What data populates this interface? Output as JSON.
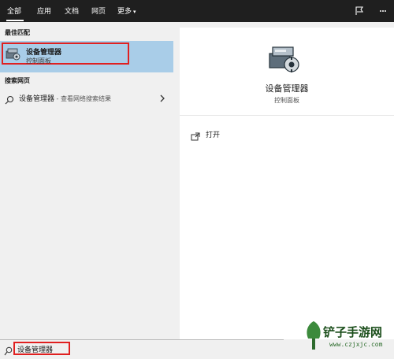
{
  "tabs": {
    "all": "全部",
    "apps": "应用",
    "docs": "文档",
    "web": "网页",
    "more": "更多",
    "more_caret": "▾",
    "feedback_icon": "feedback-icon",
    "options_icon": "more-options-icon"
  },
  "left": {
    "best_match_label": "最佳匹配",
    "best_match": {
      "title": "设备管理器",
      "subtitle": "控制面板",
      "icon": "device-manager-icon"
    },
    "web_label": "搜索网页",
    "web_result": {
      "query": "设备管理器",
      "separator": " - ",
      "suffix": "查看网络搜索结果",
      "icon": "search-icon"
    }
  },
  "right": {
    "title": "设备管理器",
    "subtitle": "控制面板",
    "actions": [
      {
        "label": "打开",
        "icon": "open-icon"
      }
    ]
  },
  "search": {
    "value": "设备管理器",
    "icon": "search-icon"
  },
  "watermark": {
    "text": "铲子手游网",
    "url": "www.czjxjc.com"
  },
  "colors": {
    "topbar": "#1f1f1f",
    "selected": "#a9cde8",
    "highlight_box": "#e02020",
    "panel": "#f0f0f0"
  }
}
